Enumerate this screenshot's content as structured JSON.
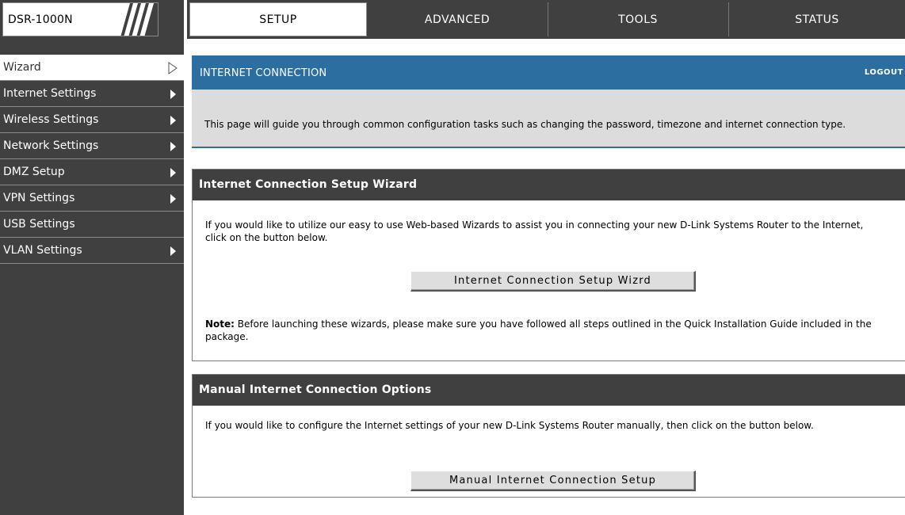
{
  "app": {
    "model": "DSR-1000N"
  },
  "tabs": [
    {
      "label": "SETUP"
    },
    {
      "label": "ADVANCED"
    },
    {
      "label": "TOOLS"
    },
    {
      "label": "STATUS"
    }
  ],
  "sidebar": {
    "items": [
      {
        "label": "Wizard",
        "active": true
      },
      {
        "label": "Internet Settings"
      },
      {
        "label": "Wireless Settings"
      },
      {
        "label": "Network Settings"
      },
      {
        "label": "DMZ Setup"
      },
      {
        "label": "VPN Settings"
      },
      {
        "label": "USB Settings"
      },
      {
        "label": "VLAN Settings"
      }
    ]
  },
  "intro": {
    "title": "INTERNET CONNECTION",
    "logout": "LOGOUT",
    "text": "This page will guide you through common configuration tasks such as changing the password, timezone and internet connection type."
  },
  "wizard_section": {
    "title": "Internet Connection Setup Wizard",
    "text": "If you would like to utilize our easy to use Web-based Wizards to assist you in connecting your new D-Link Systems Router to the Internet, click on the button below.",
    "button": "Internet Connection Setup Wizrd",
    "note_label": "Note:",
    "note_text": " Before launching these wizards, please make sure you have followed all steps outlined in the Quick Installation Guide included in the package."
  },
  "manual_section": {
    "title": "Manual Internet Connection Options",
    "text": "If you would like to configure the Internet settings of your new D-Link Systems Router manually, then click on the button below.",
    "button": "Manual Internet Connection Setup"
  },
  "colors": {
    "header_blue": "#2c6ea0",
    "dark_gray": "#404040",
    "intro_gray": "#dcdcdc"
  }
}
